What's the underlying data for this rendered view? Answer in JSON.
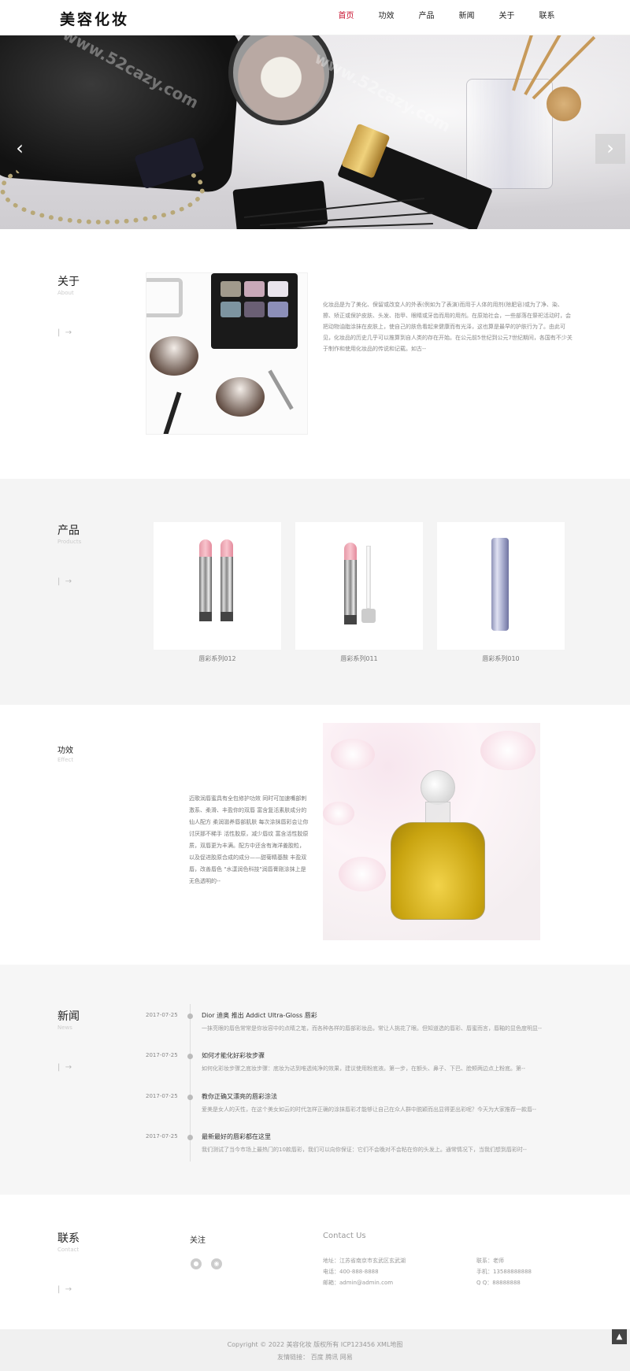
{
  "header": {
    "logo": "美容化妆",
    "nav": [
      "首页",
      "功效",
      "产品",
      "新闻",
      "关于",
      "联系"
    ],
    "active_index": 0
  },
  "banner": {
    "prev_icon": "chevron-left-icon",
    "next_icon": "chevron-right-icon",
    "watermark": "www.52cazy.com"
  },
  "about": {
    "title": "关于",
    "subtitle": "About",
    "more_icon": "arrow-right-icon",
    "text": "化妆品是为了美化、保留或改变人的外表(例如为了表演)而用于人体的用剂(除肥皂)或为了净、染、擦、矫正或保护皮肤、头发、指甲、眼睛或牙齿而用的用剂。在原始社会，一些部落在祭祀活动时，会把动物油脂涂抹在皮肤上，使自己的肤色看起来健康而有光泽，这也算是最早的护肤行为了。由此可见，化妆品的历史几乎可以推算到自人类的存在开始。在公元前5世纪到公元7世纪期间，各国有不少关于制作和使用化妆品的传说和记载。如古--"
  },
  "products": {
    "title": "产品",
    "subtitle": "Products",
    "more_icon": "arrow-right-icon",
    "items": [
      {
        "name": "唇彩系列012"
      },
      {
        "name": "唇彩系列011"
      },
      {
        "name": "唇彩系列010"
      }
    ]
  },
  "effect": {
    "title": "功效",
    "subtitle": "Effect",
    "text": "迈歌润唇蜜具有全包修护功效 同时可加速嘴部刺激系、柔滑、丰盈你的双唇 富含复活素肤成分的仙人配方 柔润滋养唇部肌肤 每次涂抹唇彩会让你讨厌那不稀手 活性胶原，减少唇纹 富含活性胶原质，双唇更为丰满。配方中还含有海洋姜胶粒，以及促进胶原合成的成分——甜菊精基酸 丰盈双唇，改善唇色 \"水漾润色科技\"润唇膏刚涂抹上是无色透明的--"
  },
  "news": {
    "title": "新闻",
    "subtitle": "News",
    "more_icon": "arrow-right-icon",
    "items": [
      {
        "date": "2017-07-25",
        "title": "Dior 迪奥 推出 Addict Ultra-Gloss 唇彩",
        "desc": "一抹亮眼的唇色常常是你妆容中的点睛之笔，而各种各样的唇部彩妆品，常让人挑花了眼。但知道选的唇彩、唇蜜而言，唇釉的显色度明显--"
      },
      {
        "date": "2017-07-25",
        "title": "如何才能化好彩妆步骤",
        "desc": "如何化彩妆步骤之底妆步骤：底妆为达到唯透纯净的效果，建议使用粉底液。第一步，在额头、鼻子、下巴、脸颊两边点上粉底。第--"
      },
      {
        "date": "2017-07-25",
        "title": "教你正确又漂亮的唇彩涂法",
        "desc": "爱美是女人的天性，在这个美女如云的时代怎样正确的涂抹唇彩才能够让自己在众人群中脱颖而出显得更出彩呢？今天为大家推荐一款唇--"
      },
      {
        "date": "2017-07-25",
        "title": "最新最好的唇彩都在这里",
        "desc": "我们测试了当今市场上最热门的10款唇彩，我们可以向你保证：它们不会晚对不会粘在你的头发上。通常情况下，当我们想到唇彩时--"
      }
    ]
  },
  "contact": {
    "title": "联系",
    "subtitle": "Contact",
    "more_icon": "arrow-right-icon",
    "follow_label": "关注",
    "social": [
      "qq-icon",
      "wechat-icon"
    ],
    "us_label": "Contact Us",
    "address": "地址：江苏省南京市玄武区玄武湖",
    "phone": "电话：400-888-8888",
    "email": "邮箱：admin@admin.com",
    "contact_person": "联系：老师",
    "mobile": "手机：13588888888",
    "qq": "Q Q：88888888"
  },
  "footer": {
    "copyright": "Copyright © 2022 美容化妆 版权所有  ICP123456  XML地图",
    "links": "友情链接：  百度  腾讯  网易",
    "to_top_icon": "arrow-up-icon"
  },
  "colors": {
    "accent": "#c8102e",
    "section_bg": "#f4f4f4"
  }
}
